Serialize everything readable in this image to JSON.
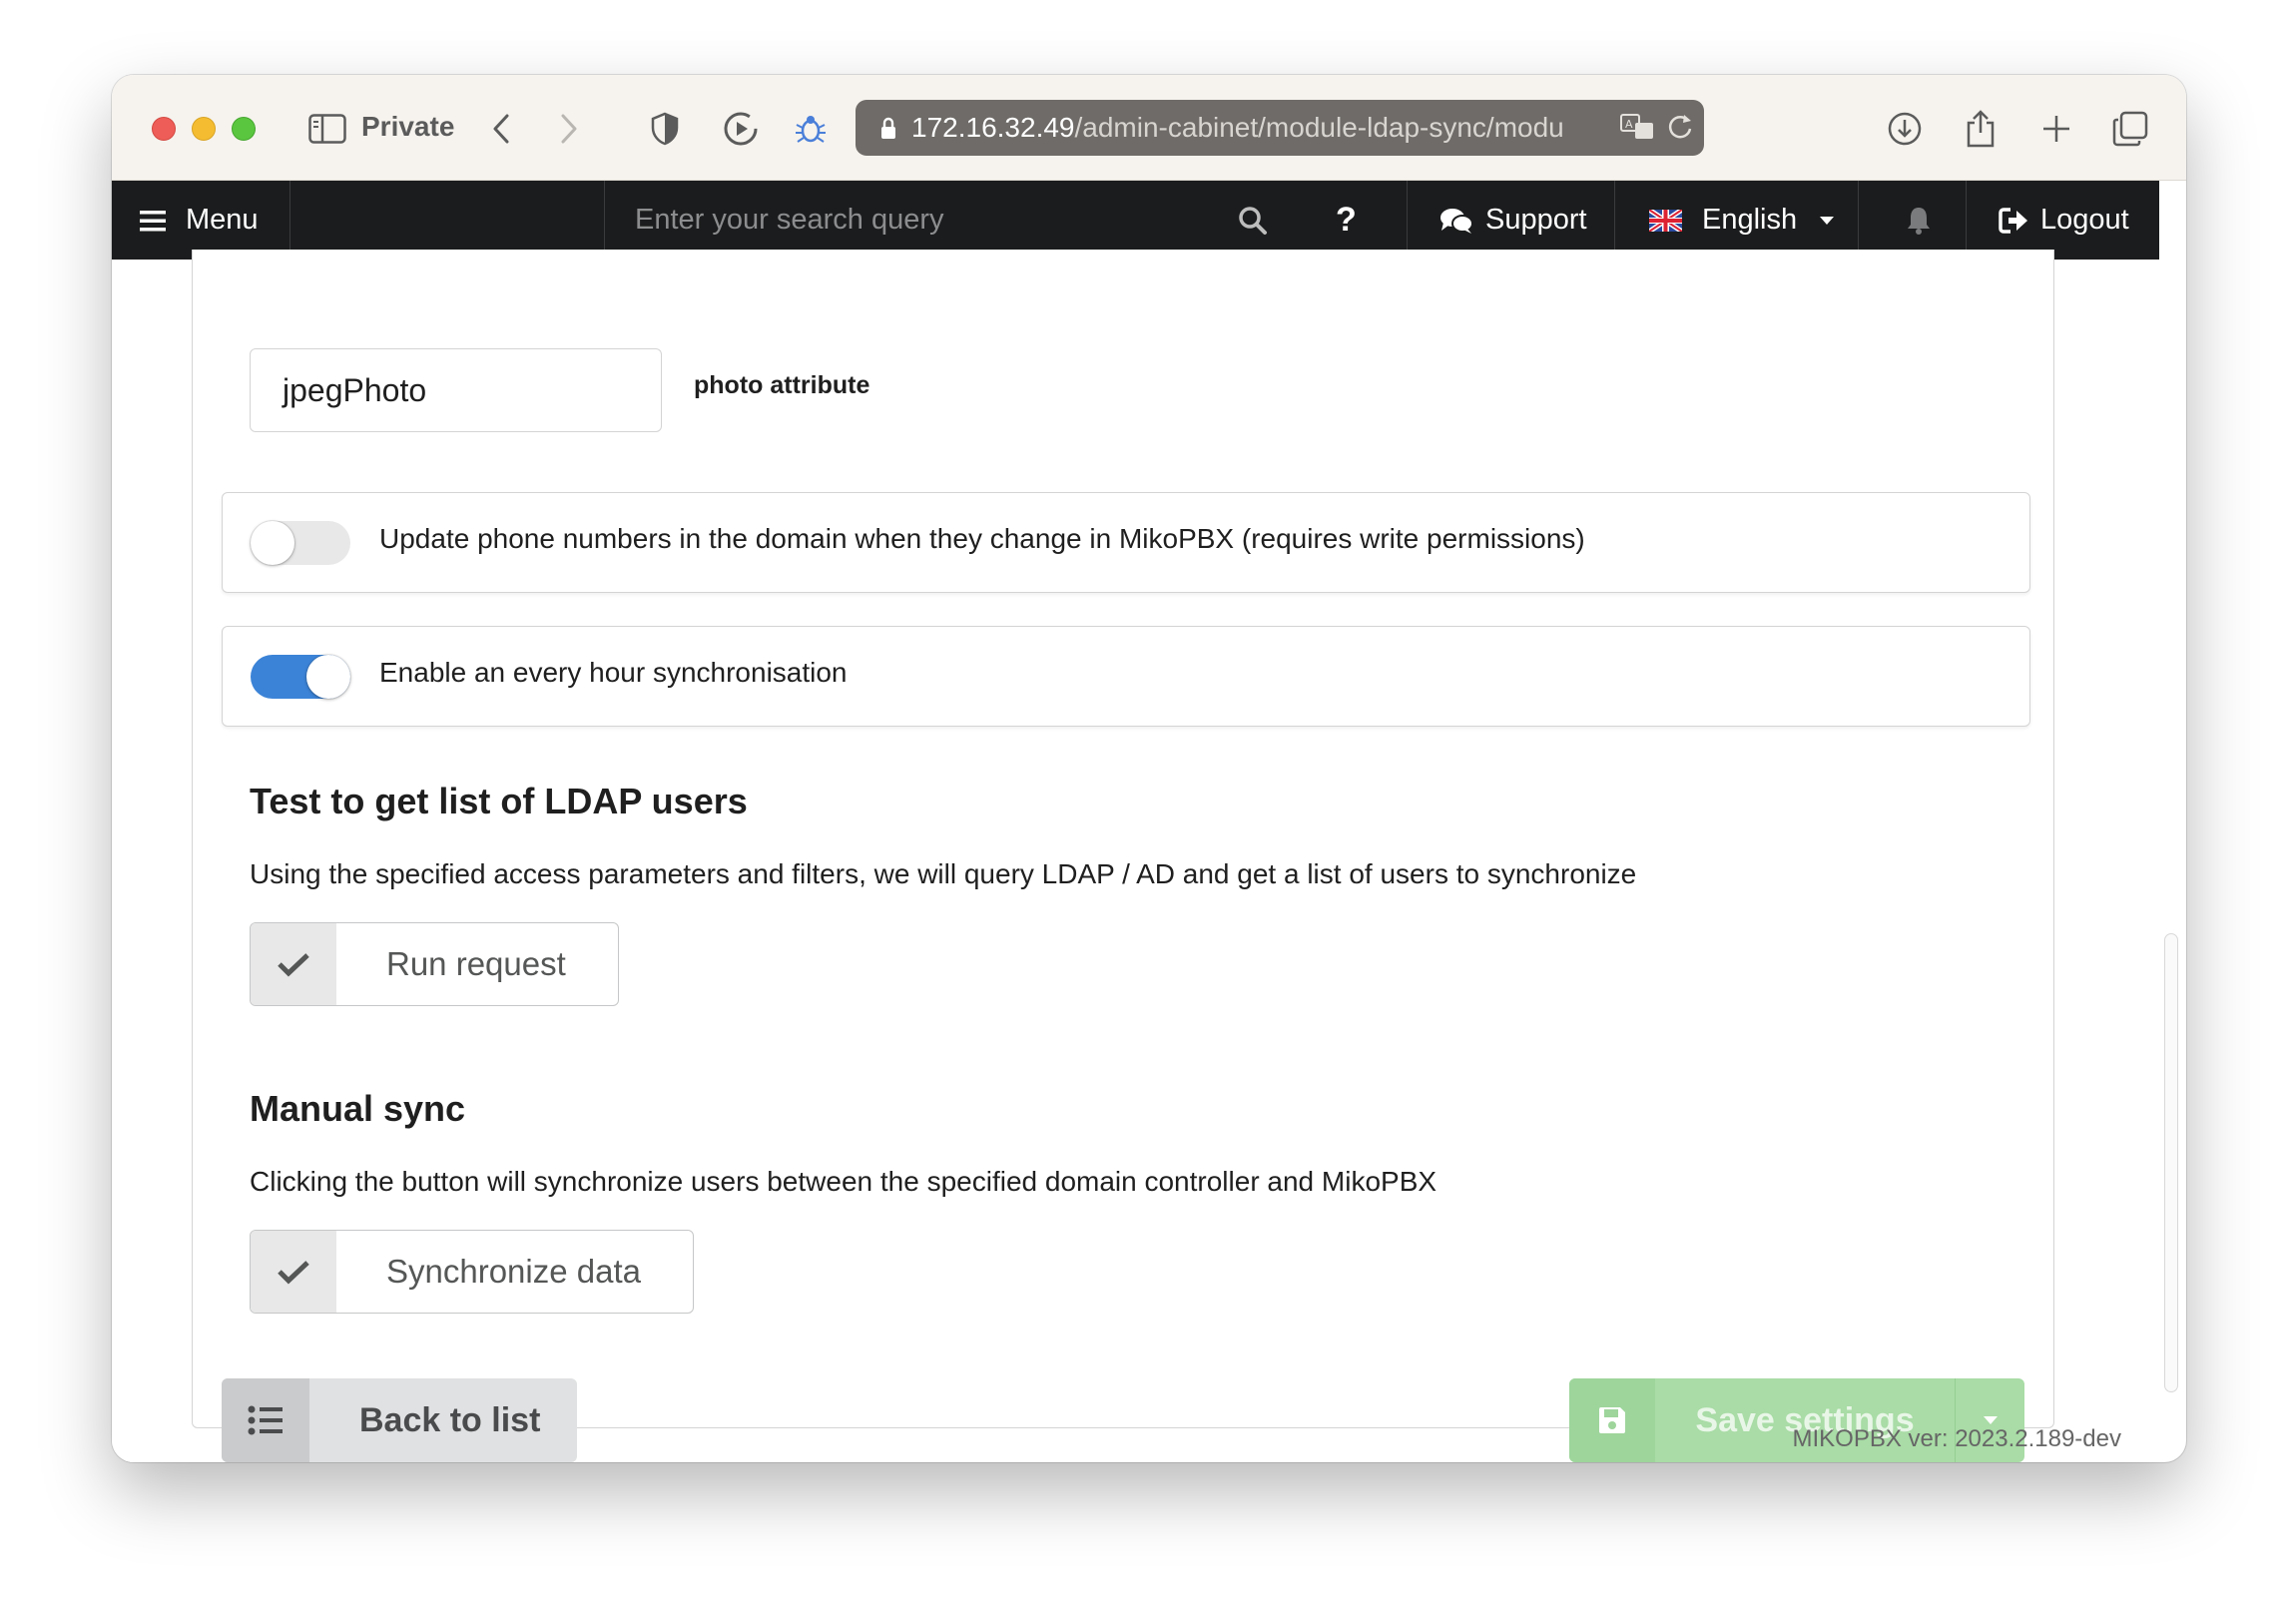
{
  "browser": {
    "private_label": "Private",
    "url_host": "172.16.32.49",
    "url_path": "/admin-cabinet/module-ldap-sync/modu"
  },
  "nav": {
    "menu_label": "Menu",
    "search_placeholder": "Enter your search query",
    "help_label": "?",
    "support_label": "Support",
    "language_label": "English",
    "logout_label": "Logout"
  },
  "form": {
    "photo_field_value": "jpegPhoto",
    "photo_field_hint": "photo attribute",
    "toggles": [
      {
        "label": "Update phone numbers in the domain when they change in MikoPBX (requires write permissions)",
        "checked": false
      },
      {
        "label": "Enable an every hour synchronisation",
        "checked": true
      }
    ]
  },
  "test_section": {
    "title": "Test to get list of LDAP users",
    "description": "Using the specified access parameters and filters, we will query LDAP / AD and get a list of users to synchronize",
    "button_label": "Run request"
  },
  "manual_section": {
    "title": "Manual sync",
    "description": "Clicking the button will synchronize users between the specified domain controller and MikoPBX",
    "button_label": "Synchronize data"
  },
  "footer": {
    "back_label": "Back to list",
    "save_label": "Save settings",
    "version": "MIKOPBX ver: 2023.2.189-dev"
  },
  "colors": {
    "toggle_on": "#3b83d7",
    "save_button": "#a9dca6",
    "nav_background": "#1b1c1d"
  }
}
